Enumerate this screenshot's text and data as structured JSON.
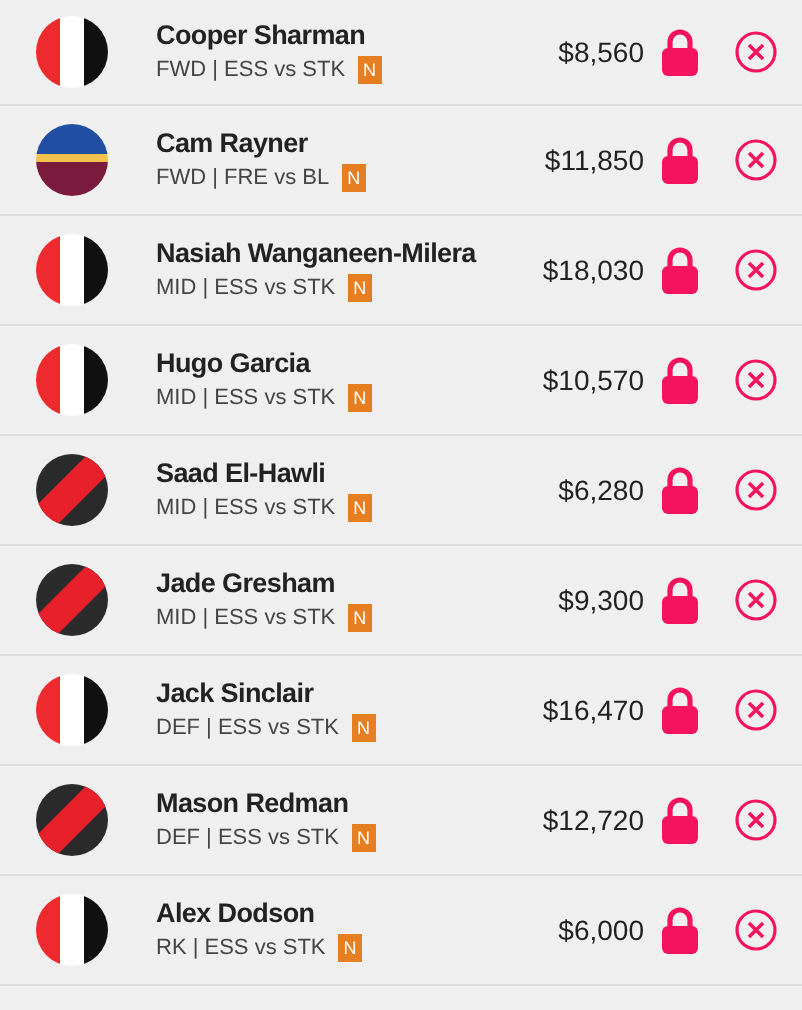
{
  "players": [
    {
      "name": "Cooper Sharman",
      "meta": "FWD | ESS vs STK",
      "badge": "N",
      "price": "$8,560",
      "kind": "stripes"
    },
    {
      "name": "Cam Rayner",
      "meta": "FWD | FRE vs BL",
      "badge": "N",
      "price": "$11,850",
      "kind": "hoops"
    },
    {
      "name": "Nasiah Wanganeen-Milera",
      "meta": "MID | ESS vs STK",
      "badge": "N",
      "price": "$18,030",
      "kind": "stripes"
    },
    {
      "name": "Hugo Garcia",
      "meta": "MID | ESS vs STK",
      "badge": "N",
      "price": "$10,570",
      "kind": "stripes"
    },
    {
      "name": "Saad El-Hawli",
      "meta": "MID | ESS vs STK",
      "badge": "N",
      "price": "$6,280",
      "kind": "sash"
    },
    {
      "name": "Jade Gresham",
      "meta": "MID | ESS vs STK",
      "badge": "N",
      "price": "$9,300",
      "kind": "sash"
    },
    {
      "name": "Jack Sinclair",
      "meta": "DEF | ESS vs STK",
      "badge": "N",
      "price": "$16,470",
      "kind": "stripes"
    },
    {
      "name": "Mason Redman",
      "meta": "DEF | ESS vs STK",
      "badge": "N",
      "price": "$12,720",
      "kind": "sash"
    },
    {
      "name": "Alex Dodson",
      "meta": "RK | ESS vs STK",
      "badge": "N",
      "price": "$6,000",
      "kind": "stripes"
    }
  ]
}
